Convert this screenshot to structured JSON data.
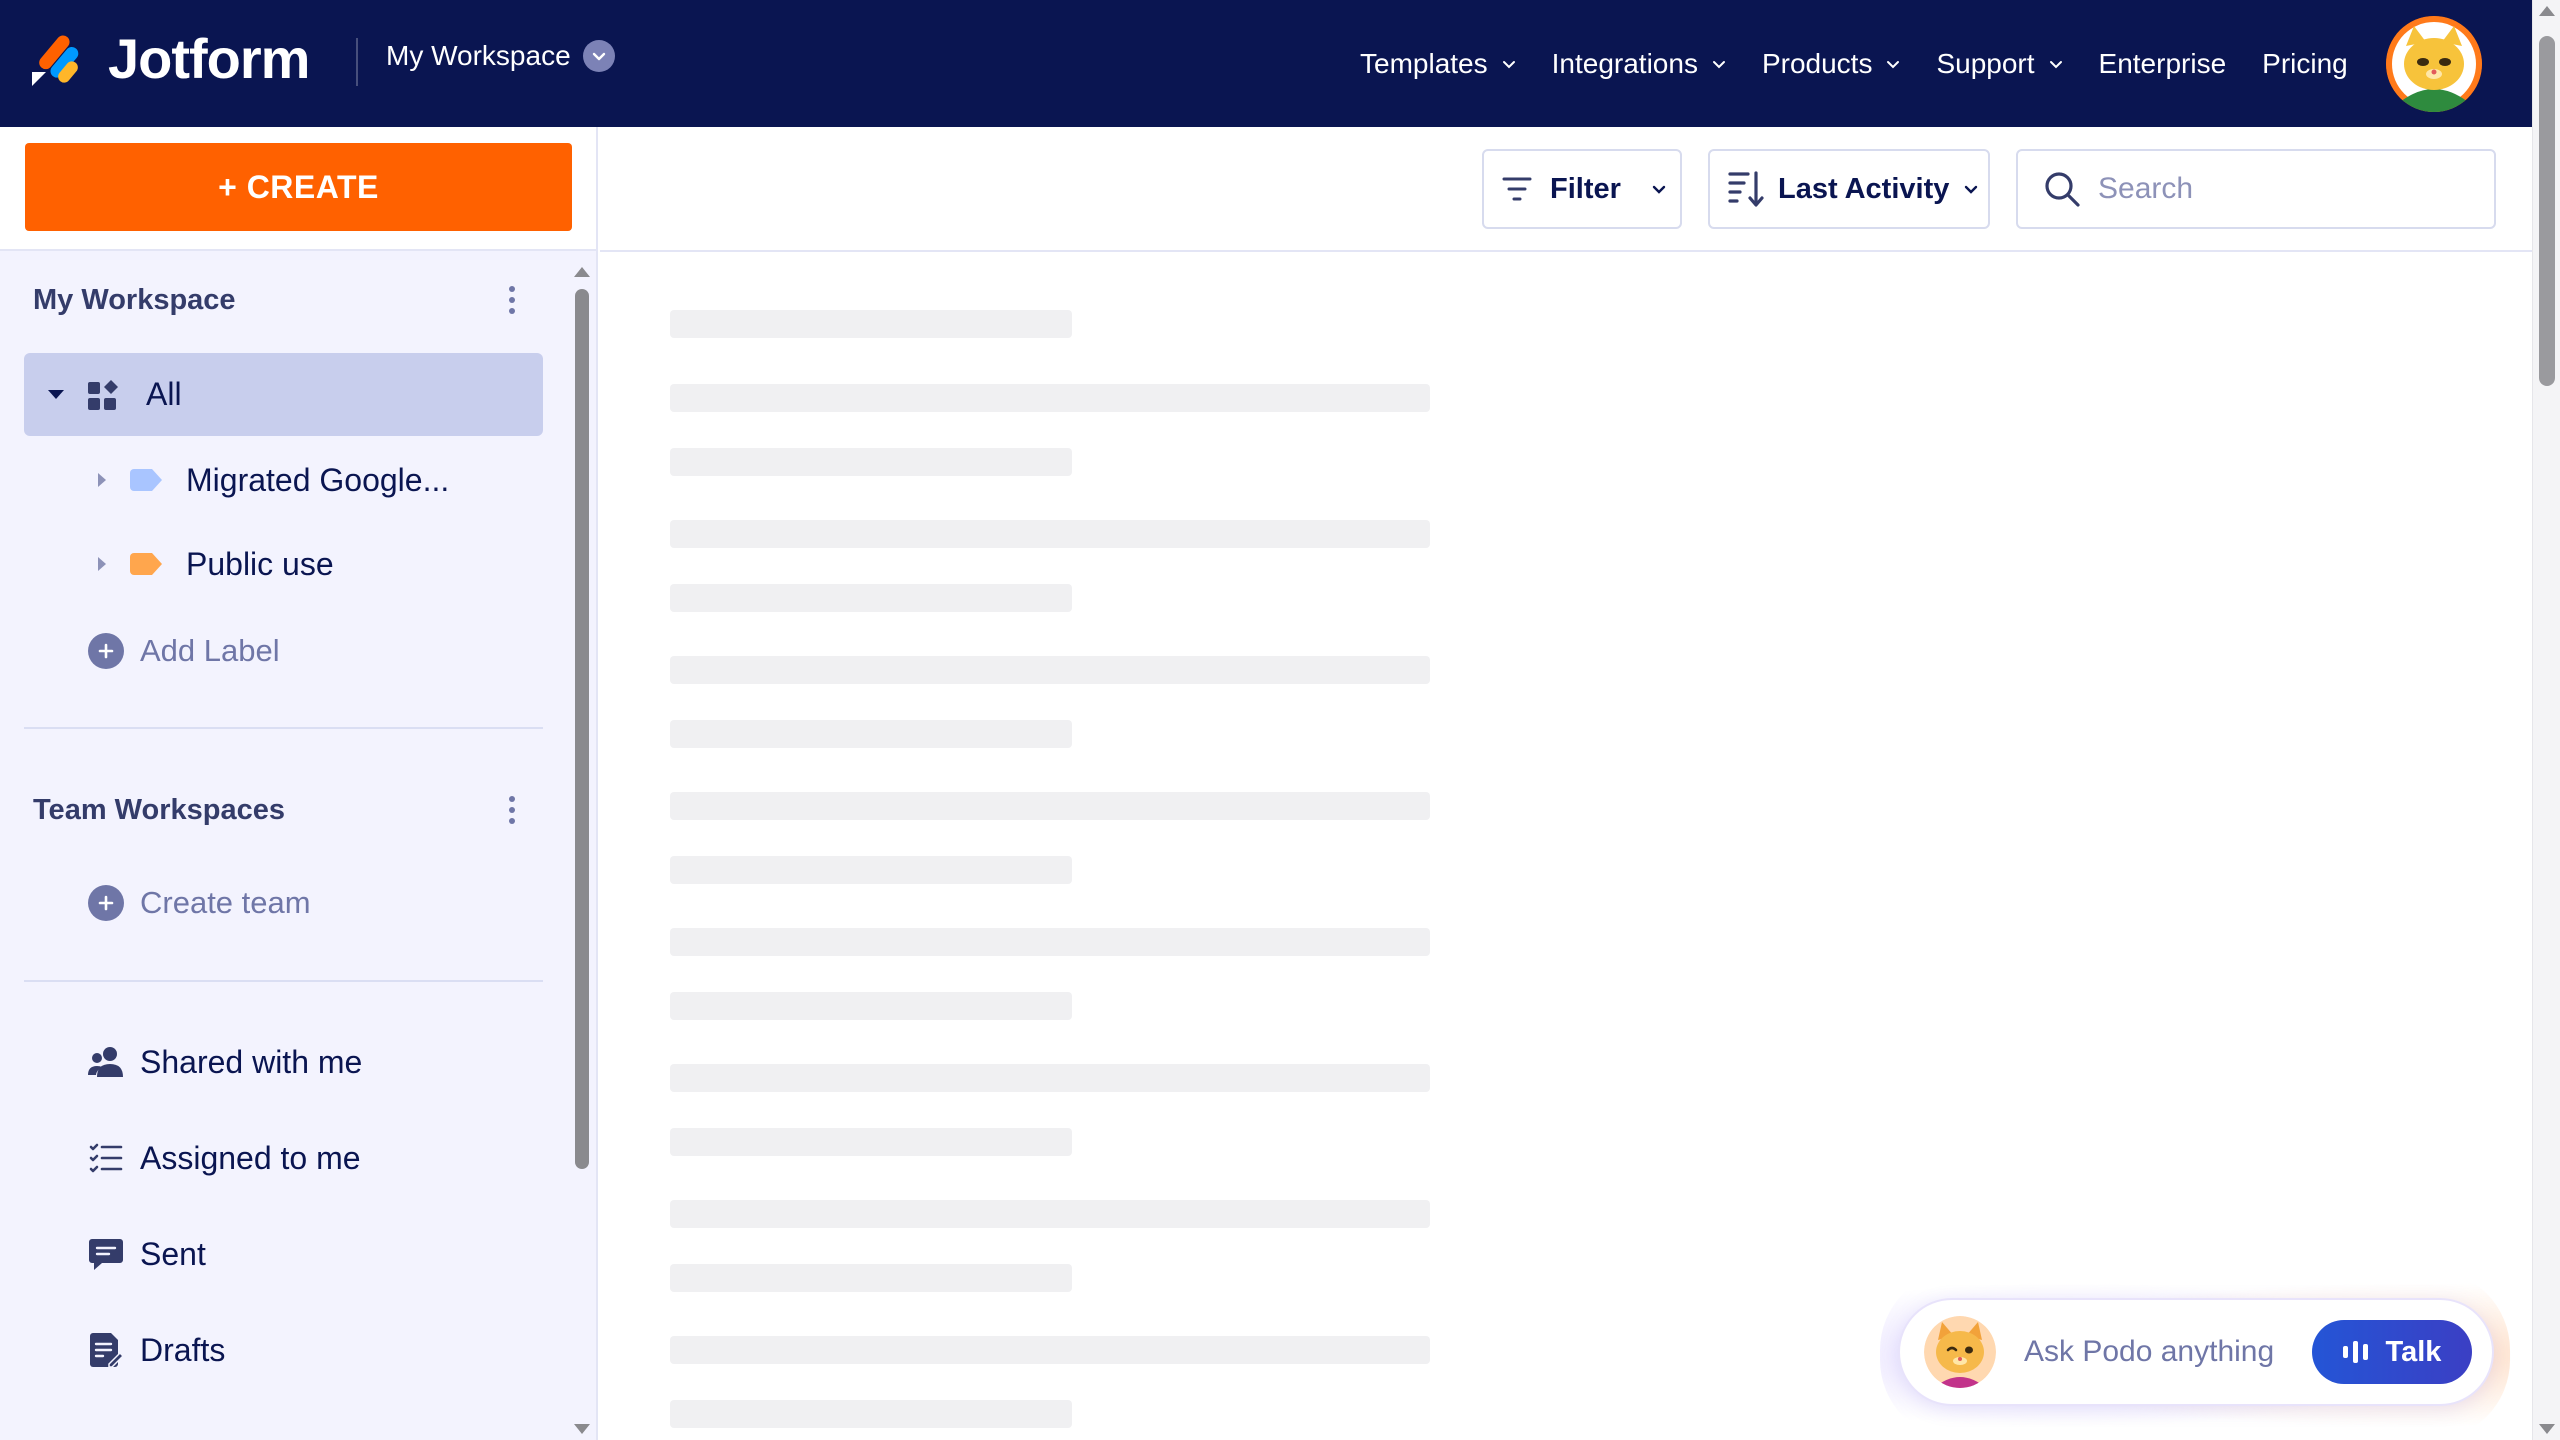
{
  "brand": {
    "name": "Jotform",
    "accent": "#ff6100",
    "nav_bg": "#0a1551"
  },
  "header": {
    "workspace_label": "My Workspace",
    "nav": [
      {
        "label": "Templates",
        "has_dropdown": true
      },
      {
        "label": "Integrations",
        "has_dropdown": true
      },
      {
        "label": "Products",
        "has_dropdown": true
      },
      {
        "label": "Support",
        "has_dropdown": true
      },
      {
        "label": "Enterprise",
        "has_dropdown": false
      },
      {
        "label": "Pricing",
        "has_dropdown": false
      }
    ]
  },
  "sidebar": {
    "create_label": "+ CREATE",
    "my_workspace": {
      "title": "My Workspace",
      "all_label": "All",
      "labels": [
        {
          "name": "Migrated Google...",
          "color": "#a9c5ff"
        },
        {
          "name": "Public use",
          "color": "#ffa64d"
        }
      ],
      "add_label": "Add Label"
    },
    "team_workspaces": {
      "title": "Team Workspaces",
      "create_team": "Create team"
    },
    "links": [
      {
        "label": "Shared with me",
        "icon": "people-icon"
      },
      {
        "label": "Assigned to me",
        "icon": "checklist-icon"
      },
      {
        "label": "Sent",
        "icon": "message-icon"
      },
      {
        "label": "Drafts",
        "icon": "draft-icon"
      }
    ]
  },
  "toolbar": {
    "filter_label": "Filter",
    "sort_label": "Last Activity",
    "search_placeholder": "Search"
  },
  "podo": {
    "ask_label": "Ask Podo anything",
    "talk_label": "Talk"
  }
}
